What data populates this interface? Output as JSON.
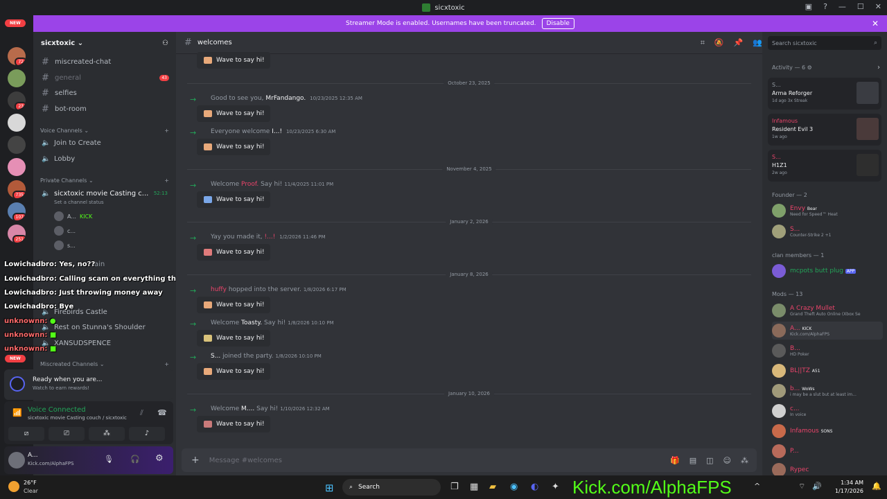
{
  "titlebar": {
    "title": "sicxtoxic"
  },
  "banner": {
    "text": "Streamer Mode is enabled. Usernames have been truncated.",
    "disable_label": "Disable"
  },
  "servers": {
    "new_label": "NEW",
    "badges": [
      "72",
      "23",
      "735",
      "107",
      "251"
    ]
  },
  "guild": {
    "name": "sicxtoxic"
  },
  "channels": {
    "text": [
      {
        "name": "miscreated-chat"
      },
      {
        "name": "general",
        "badge": "43"
      },
      {
        "name": "selfies"
      },
      {
        "name": "bot-room"
      }
    ],
    "voice_category": "Voice Channels",
    "voice": [
      "Join to Create",
      "Lobby"
    ],
    "private_category": "Private Channels",
    "private_channel": {
      "name": "sicxtoxic movie Casting c...",
      "time": "52:13",
      "status": "Set a channel status"
    },
    "voice_users": [
      {
        "name": "A...",
        "tag": "KICK"
      },
      {
        "name": "c..."
      },
      {
        "name": "s..."
      }
    ],
    "more_voice": [
      "Firebirds Castle",
      "Rest on Stunna's Shoulder",
      "XANSUDSPENCE"
    ],
    "miscreated_category": "Miscreated Channels",
    "partial_label": "tain"
  },
  "overlay_chat": [
    {
      "name": "Lowichadbro:",
      "text": "Yes, no??"
    },
    {
      "name": "Lowichadbro:",
      "text": "Calling scam on everything that's smart"
    },
    {
      "name": "Lowichadbro:",
      "text": "Just throwing money away"
    },
    {
      "name": "Lowichadbro:",
      "text": "Bye"
    },
    {
      "name": "unknownn:",
      "text": ""
    },
    {
      "name": "unknownn:",
      "text": ""
    },
    {
      "name": "unknownn:",
      "text": ""
    }
  ],
  "panels": {
    "quest_title": "Ready when you are...",
    "quest_sub": "Watch to earn rewards!",
    "voice_connected": "Voice Connected",
    "voice_path": "sicxtoxic movie Casting couch / sicxtoxic",
    "user_name": "A...",
    "user_status": "Kick.com/AlphaFPS"
  },
  "main": {
    "channel": "welcomes",
    "wave_label": "Wave to say hi!",
    "dates": [
      "October 23, 2025",
      "November 4, 2025",
      "January 2, 2026",
      "January 8, 2026",
      "January 10, 2026"
    ],
    "messages": [
      {
        "pre": "Good to see you,",
        "name": "MrFandango.",
        "post": "",
        "ts": "10/23/2025 12:35 AM"
      },
      {
        "pre": "Everyone welcome",
        "name": "I...!",
        "post": "",
        "ts": "10/23/2025 6:30 AM"
      },
      {
        "pre": "Welcome",
        "name": "Proof.",
        "post": "Say hi!",
        "ts": "11/4/2025 11:01 PM"
      },
      {
        "pre": "Yay you made it,",
        "name": "!...!",
        "post": "",
        "ts": "1/2/2026 11:46 PM"
      },
      {
        "pre": "",
        "name": "huffy",
        "post": "hopped into the server.",
        "ts": "1/8/2026 6:17 PM"
      },
      {
        "pre": "Welcome",
        "name": "Toasty.",
        "post": "Say hi!",
        "ts": "1/8/2026 10:10 PM"
      },
      {
        "pre": "",
        "name": "S...",
        "post": "joined the party.",
        "ts": "1/8/2026 10:10 PM"
      },
      {
        "pre": "Welcome",
        "name": "M....",
        "post": "Say hi!",
        "ts": "1/10/2026 12:32 AM"
      }
    ],
    "composer_placeholder": "Message #welcomes"
  },
  "members": {
    "search_placeholder": "Search sicxtoxic",
    "activity_label": "Activity — 6",
    "activities": [
      {
        "user": "S...",
        "game": "Arma Reforger",
        "sub": "1d ago  3x Streak"
      },
      {
        "user": "Infamous",
        "game": "Resident Evil 3",
        "sub": "1w ago"
      },
      {
        "user": "S...",
        "game": "H1Z1",
        "sub": "2w ago"
      }
    ],
    "groups": [
      {
        "label": "Founder — 2",
        "members": [
          {
            "name": "Envy",
            "tag": "Bear",
            "status": "Need for Speed™ Heat",
            "color": "#e9446a"
          },
          {
            "name": "S...",
            "tag": "",
            "status": "Counter-Strike 2 +1",
            "color": "#e9446a"
          }
        ]
      },
      {
        "label": "clan members — 1",
        "members": [
          {
            "name": "mcpots butt plug",
            "tag": "APP",
            "status": "",
            "color": "#23a559"
          }
        ]
      },
      {
        "label": "Mods — 13",
        "members": [
          {
            "name": "A Crazy Mullet",
            "tag": "",
            "status": "Grand Theft Auto Online (Xbox Se",
            "color": "#e9446a"
          },
          {
            "name": "A...",
            "tag": "KICK",
            "status": "Kick.com/AlphaFPS",
            "color": "#e9446a"
          },
          {
            "name": "B...",
            "tag": "",
            "status": "HD Poker",
            "color": "#e9446a"
          },
          {
            "name": "BL||TZ",
            "tag": "A51",
            "status": "",
            "color": "#e9446a"
          },
          {
            "name": "b...",
            "tag": "WoWs",
            "status": "i may be a slut but at least im...",
            "color": "#e9446a"
          },
          {
            "name": "c...",
            "tag": "",
            "status": "In voice",
            "color": "#e9446a"
          },
          {
            "name": "Infamous",
            "tag": "SONS",
            "status": "",
            "color": "#e9446a"
          },
          {
            "name": "P...",
            "tag": "",
            "status": "",
            "color": "#e9446a"
          },
          {
            "name": "Rypec",
            "tag": "",
            "status": "",
            "color": "#e9446a"
          }
        ]
      }
    ]
  },
  "taskbar": {
    "weather_temp": "26°F",
    "weather_desc": "Clear",
    "search_label": "Search",
    "kick_text": "Kick.com/AlphaFPS",
    "time": "1:34 AM",
    "date": "1/17/2026"
  }
}
